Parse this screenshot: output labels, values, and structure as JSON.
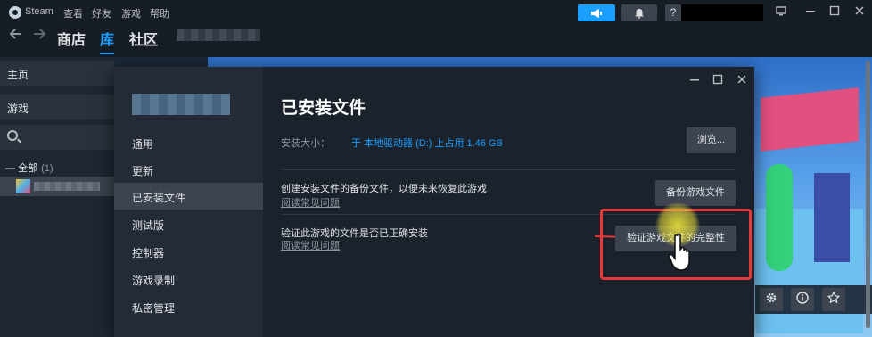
{
  "menubar": {
    "app": "Steam",
    "items": [
      "查看",
      "好友",
      "游戏",
      "帮助"
    ],
    "help_glyph": "?"
  },
  "nav": {
    "links": [
      "商店",
      "库",
      "社区"
    ],
    "active": "库"
  },
  "sidebar": {
    "home_label": "主页",
    "games_label": "游戏",
    "all_label": "— 全部",
    "all_count": "(1)"
  },
  "dialog": {
    "nav_items": [
      "通用",
      "更新",
      "已安装文件",
      "测试版",
      "控制器",
      "游戏录制",
      "私密管理"
    ],
    "active_item": "已安装文件",
    "heading": "已安装文件",
    "size_label": "安装大小：",
    "size_value": "于 本地驱动器 (D:) 上占用 1.46 GB",
    "browse_label": "浏览...",
    "backup_text": "创建安装文件的备份文件，以便未来恢复此游戏",
    "faq_text": "阅读常见问题",
    "backup_button": "备份游戏文件",
    "verify_text": "验证此游戏的文件是否已正确安装",
    "verify_button": "验证游戏文件的完整性"
  },
  "colors": {
    "accent": "#1a9fff",
    "highlight": "#e63a3a",
    "panel": "#1b222c"
  },
  "icons": [
    "steam-icon",
    "megaphone-icon",
    "bell-icon",
    "monitor-icon",
    "minimize-icon",
    "maximize-icon",
    "close-icon",
    "back-arrow-icon",
    "forward-arrow-icon",
    "search-icon",
    "gear-icon",
    "info-icon",
    "star-icon",
    "hand-cursor-icon"
  ]
}
